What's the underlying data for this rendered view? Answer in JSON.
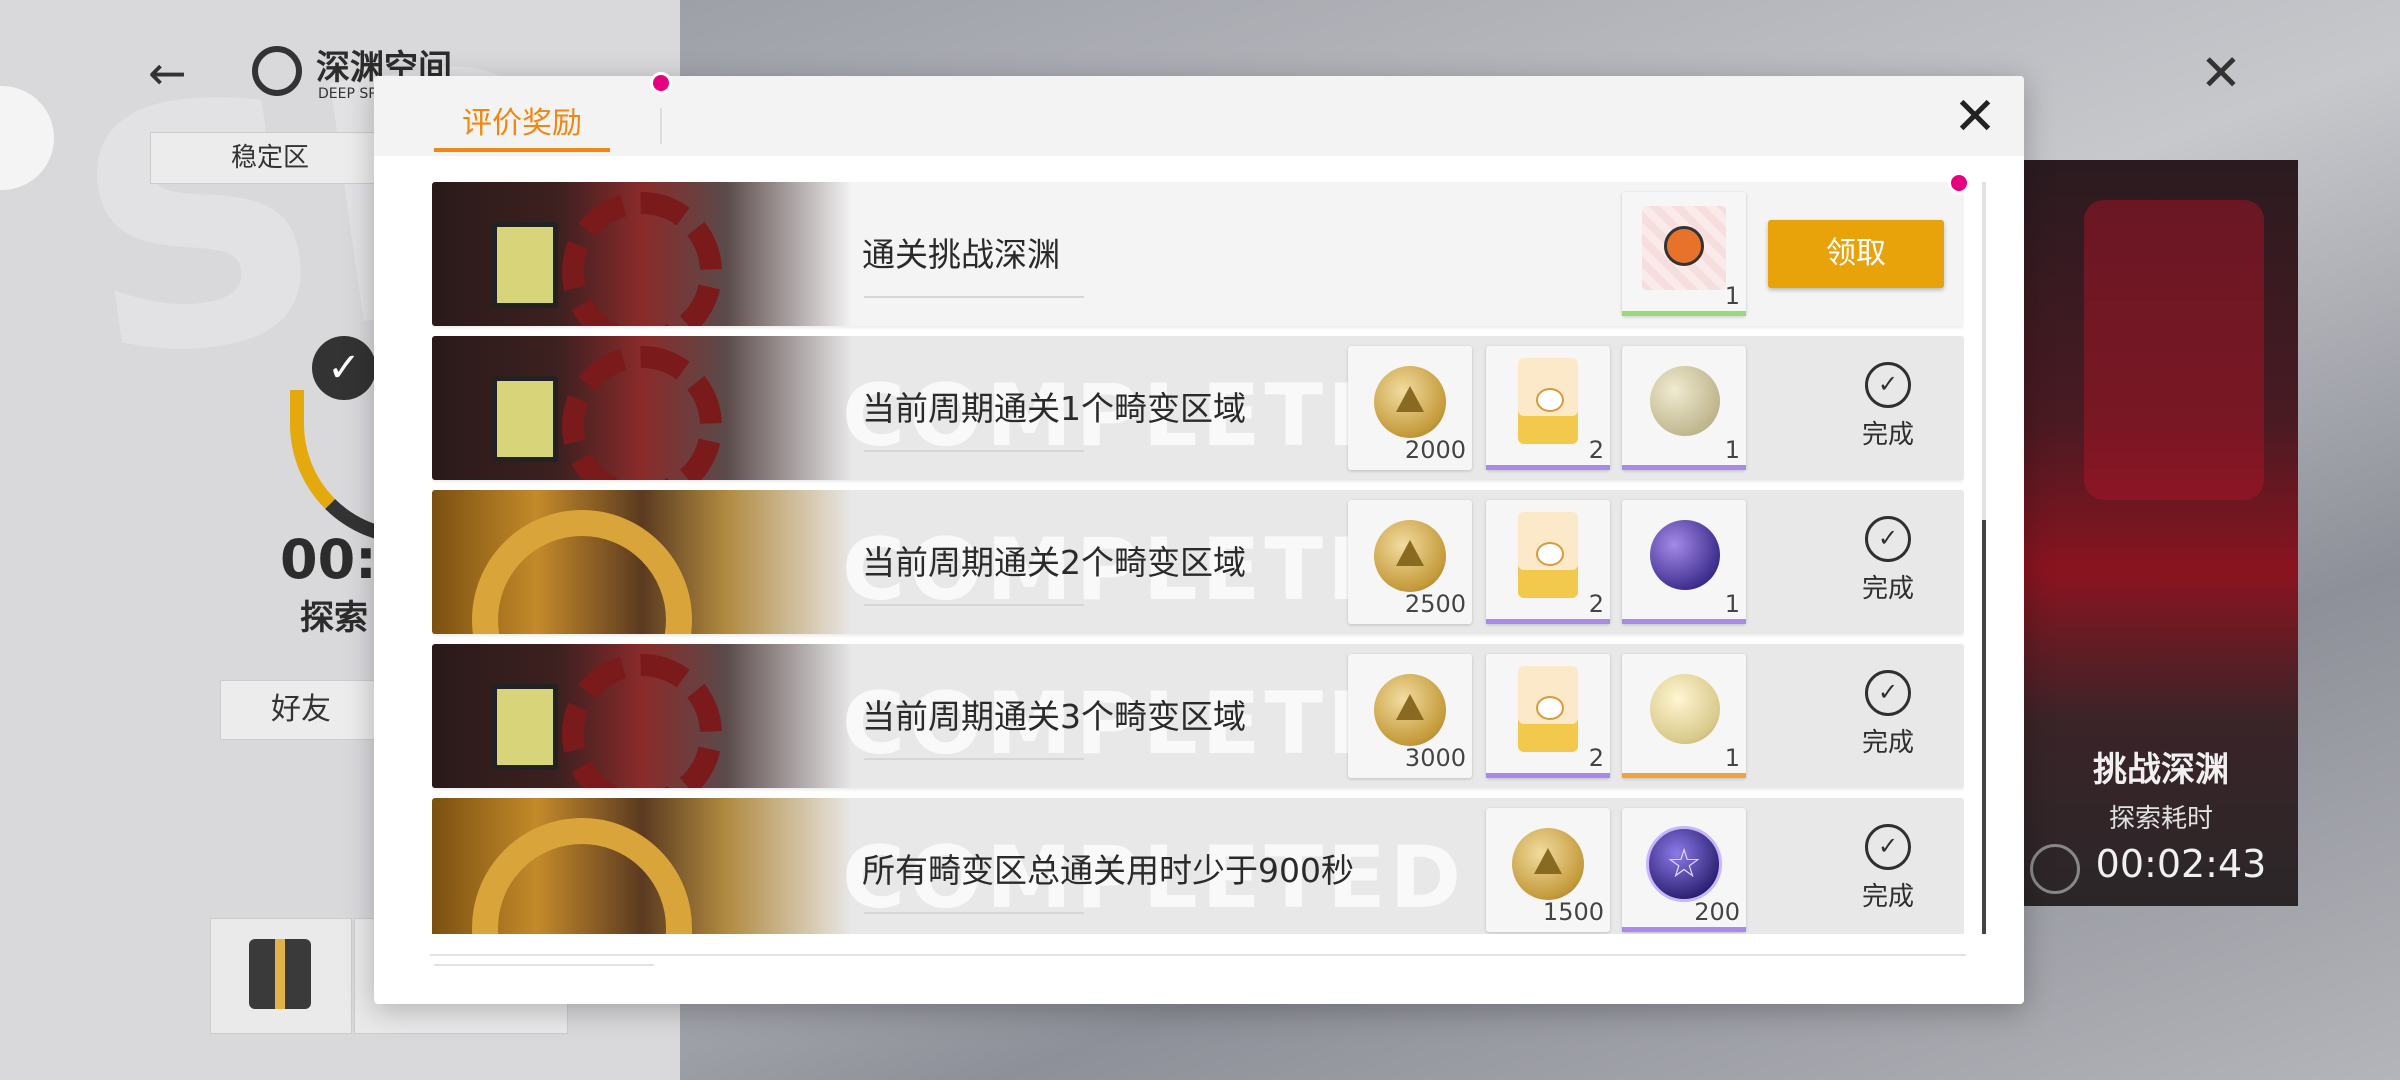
{
  "background": {
    "brand_title": "深渊空间",
    "brand_sub": "DEEP SP",
    "zone_tab": "稳定区",
    "time_partial": "00:0",
    "explore_partial": "探索",
    "friend_partial": "好友",
    "stage_title": "挑战深渊",
    "stage_sub": "探索耗时",
    "stage_time": "00:02:43"
  },
  "modal": {
    "tab_label": "评价奖励",
    "close_icon": "close-icon"
  },
  "rows": [
    {
      "title": "通关挑战深渊",
      "ghost": "",
      "status": "claimable",
      "claim_label": "领取",
      "rewards": [
        {
          "icon": "avatar-frame-icon",
          "qty": "1",
          "rarity_color": "#9ad97a"
        }
      ]
    },
    {
      "title": "当前周期通关1个畸变区域",
      "ghost": "COMPLETED",
      "status": "done",
      "done_label": "完成",
      "rewards": [
        {
          "icon": "gold-coin-icon",
          "qty": "2000",
          "rarity_color": "#f6f6f6"
        },
        {
          "icon": "milk-carton-icon",
          "qty": "2",
          "rarity_color": "#a98ae8"
        },
        {
          "icon": "moon-gem-icon",
          "qty": "1",
          "rarity_color": "#a98ae8"
        }
      ]
    },
    {
      "title": "当前周期通关2个畸变区域",
      "ghost": "COMPLETED",
      "status": "done",
      "done_label": "完成",
      "rewards": [
        {
          "icon": "gold-coin-icon",
          "qty": "2500",
          "rarity_color": "#f6f6f6"
        },
        {
          "icon": "milk-carton-icon",
          "qty": "2",
          "rarity_color": "#a98ae8"
        },
        {
          "icon": "purple-moon-gem-icon",
          "qty": "1",
          "rarity_color": "#a98ae8"
        }
      ]
    },
    {
      "title": "当前周期通关3个畸变区域",
      "ghost": "COMPLETED",
      "status": "done",
      "done_label": "完成",
      "rewards": [
        {
          "icon": "gold-coin-icon",
          "qty": "3000",
          "rarity_color": "#f6f6f6"
        },
        {
          "icon": "milk-carton-icon",
          "qty": "2",
          "rarity_color": "#a98ae8"
        },
        {
          "icon": "gold-gem-icon",
          "qty": "1",
          "rarity_color": "#f2a23a"
        }
      ]
    },
    {
      "title": "所有畸变区总通关用时少于900秒",
      "ghost": "COMPLETED",
      "status": "done",
      "done_label": "完成",
      "rewards": [
        {
          "icon": "gold-coin-icon",
          "qty": "1500",
          "rarity_color": "#f6f6f6"
        },
        {
          "icon": "star-medal-icon",
          "qty": "200",
          "rarity_color": "#a98ae8"
        }
      ]
    }
  ],
  "colors": {
    "accent_orange": "#f0870e",
    "claim_button": "#e8a20a",
    "notify_dot": "#e5007f"
  }
}
